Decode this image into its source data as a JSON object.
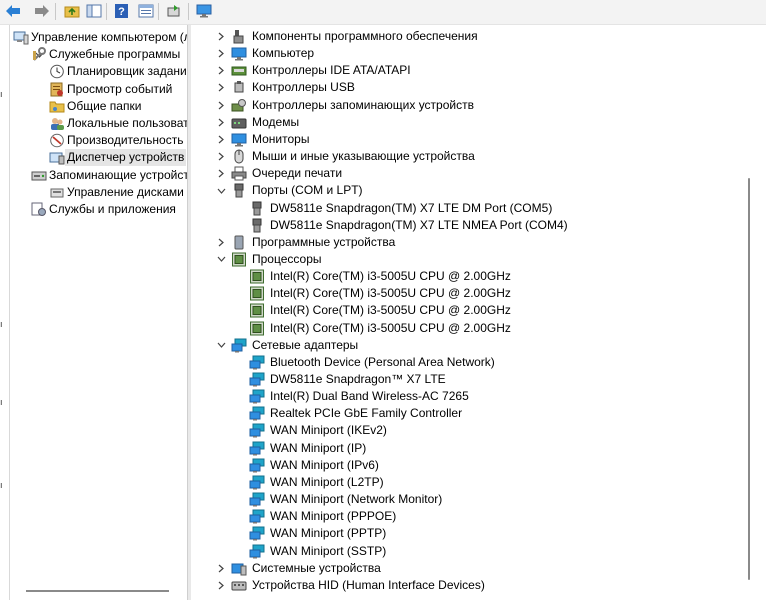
{
  "toolbar": {
    "buttons": [
      {
        "name": "back-button",
        "icon": "arrow-left-icon"
      },
      {
        "name": "forward-button",
        "icon": "arrow-right-icon"
      },
      {
        "name": "up-folder-button",
        "icon": "folder-up-icon"
      },
      {
        "name": "show-hide-tree-button",
        "icon": "console-tree-icon"
      },
      {
        "name": "help-button",
        "icon": "help-icon"
      },
      {
        "name": "properties-button",
        "icon": "properties-icon"
      },
      {
        "name": "update-driver-button",
        "icon": "update-driver-icon"
      },
      {
        "name": "scan-hardware-button",
        "icon": "monitor-scan-icon"
      }
    ]
  },
  "left_tree": [
    {
      "label": "Управление компьютером (л",
      "icon": "computer-management-icon",
      "level": 0,
      "chevron": "none"
    },
    {
      "label": "Служебные программы",
      "icon": "tools-icon",
      "level": 1,
      "chevron": "expanded"
    },
    {
      "label": "Планировщик заданий",
      "icon": "clock-icon",
      "level": 2,
      "chevron": "collapsed"
    },
    {
      "label": "Просмотр событий",
      "icon": "event-viewer-icon",
      "level": 2,
      "chevron": "collapsed"
    },
    {
      "label": "Общие папки",
      "icon": "shared-folder-icon",
      "level": 2,
      "chevron": "collapsed"
    },
    {
      "label": "Локальные пользовате",
      "icon": "users-icon",
      "level": 2,
      "chevron": "collapsed"
    },
    {
      "label": "Производительность",
      "icon": "performance-icon",
      "level": 2,
      "chevron": "collapsed"
    },
    {
      "label": "Диспетчер устройств",
      "icon": "device-manager-icon",
      "level": 2,
      "chevron": "none",
      "selected": true
    },
    {
      "label": "Запоминающие устройст",
      "icon": "storage-icon",
      "level": 1,
      "chevron": "expanded"
    },
    {
      "label": "Управление дисками",
      "icon": "disk-management-icon",
      "level": 2,
      "chevron": "none"
    },
    {
      "label": "Службы и приложения",
      "icon": "services-icon",
      "level": 1,
      "chevron": "collapsed"
    }
  ],
  "device_tree": [
    {
      "label": "Компоненты программного обеспечения",
      "icon": "software-component-icon",
      "level": 0,
      "chevron": "collapsed"
    },
    {
      "label": "Компьютер",
      "icon": "computer-icon",
      "level": 0,
      "chevron": "collapsed"
    },
    {
      "label": "Контроллеры IDE ATA/ATAPI",
      "icon": "ide-controller-icon",
      "level": 0,
      "chevron": "collapsed"
    },
    {
      "label": "Контроллеры USB",
      "icon": "usb-icon",
      "level": 0,
      "chevron": "collapsed"
    },
    {
      "label": "Контроллеры запоминающих устройств",
      "icon": "storage-controller-icon",
      "level": 0,
      "chevron": "collapsed"
    },
    {
      "label": "Модемы",
      "icon": "modem-icon",
      "level": 0,
      "chevron": "collapsed"
    },
    {
      "label": "Мониторы",
      "icon": "monitor-icon",
      "level": 0,
      "chevron": "collapsed"
    },
    {
      "label": "Мыши и иные указывающие устройства",
      "icon": "mouse-icon",
      "level": 0,
      "chevron": "collapsed"
    },
    {
      "label": "Очереди печати",
      "icon": "printer-icon",
      "level": 0,
      "chevron": "collapsed"
    },
    {
      "label": "Порты (COM и LPT)",
      "icon": "port-icon",
      "level": 0,
      "chevron": "expanded"
    },
    {
      "label": "DW5811e Snapdragon(TM) X7 LTE DM Port (COM5)",
      "icon": "port-icon",
      "level": 1,
      "chevron": "none"
    },
    {
      "label": "DW5811e Snapdragon(TM) X7 LTE NMEA Port (COM4)",
      "icon": "port-icon",
      "level": 1,
      "chevron": "none"
    },
    {
      "label": "Программные устройства",
      "icon": "software-device-icon",
      "level": 0,
      "chevron": "collapsed"
    },
    {
      "label": "Процессоры",
      "icon": "processor-icon",
      "level": 0,
      "chevron": "expanded"
    },
    {
      "label": "Intel(R) Core(TM) i3-5005U CPU @ 2.00GHz",
      "icon": "processor-icon",
      "level": 1,
      "chevron": "none"
    },
    {
      "label": "Intel(R) Core(TM) i3-5005U CPU @ 2.00GHz",
      "icon": "processor-icon",
      "level": 1,
      "chevron": "none"
    },
    {
      "label": "Intel(R) Core(TM) i3-5005U CPU @ 2.00GHz",
      "icon": "processor-icon",
      "level": 1,
      "chevron": "none"
    },
    {
      "label": "Intel(R) Core(TM) i3-5005U CPU @ 2.00GHz",
      "icon": "processor-icon",
      "level": 1,
      "chevron": "none"
    },
    {
      "label": "Сетевые адаптеры",
      "icon": "network-adapter-icon",
      "level": 0,
      "chevron": "expanded"
    },
    {
      "label": "Bluetooth Device (Personal Area Network)",
      "icon": "network-adapter-icon",
      "level": 1,
      "chevron": "none"
    },
    {
      "label": "DW5811e Snapdragon™ X7 LTE",
      "icon": "network-adapter-icon",
      "level": 1,
      "chevron": "none"
    },
    {
      "label": "Intel(R) Dual Band Wireless-AC 7265",
      "icon": "network-adapter-icon",
      "level": 1,
      "chevron": "none"
    },
    {
      "label": "Realtek PCIe GbE Family Controller",
      "icon": "network-adapter-icon",
      "level": 1,
      "chevron": "none"
    },
    {
      "label": "WAN Miniport (IKEv2)",
      "icon": "network-adapter-icon",
      "level": 1,
      "chevron": "none"
    },
    {
      "label": "WAN Miniport (IP)",
      "icon": "network-adapter-icon",
      "level": 1,
      "chevron": "none"
    },
    {
      "label": "WAN Miniport (IPv6)",
      "icon": "network-adapter-icon",
      "level": 1,
      "chevron": "none"
    },
    {
      "label": "WAN Miniport (L2TP)",
      "icon": "network-adapter-icon",
      "level": 1,
      "chevron": "none"
    },
    {
      "label": "WAN Miniport (Network Monitor)",
      "icon": "network-adapter-icon",
      "level": 1,
      "chevron": "none"
    },
    {
      "label": "WAN Miniport (PPPOE)",
      "icon": "network-adapter-icon",
      "level": 1,
      "chevron": "none"
    },
    {
      "label": "WAN Miniport (PPTP)",
      "icon": "network-adapter-icon",
      "level": 1,
      "chevron": "none"
    },
    {
      "label": "WAN Miniport (SSTP)",
      "icon": "network-adapter-icon",
      "level": 1,
      "chevron": "none"
    },
    {
      "label": "Системные устройства",
      "icon": "system-device-icon",
      "level": 0,
      "chevron": "collapsed"
    },
    {
      "label": "Устройства HID (Human Interface Devices)",
      "icon": "hid-icon",
      "level": 0,
      "chevron": "collapsed"
    }
  ],
  "colors": {
    "selection": "#e5e5e5",
    "chevron": "#444444",
    "toolbar_bg": "#f3f3f3",
    "monitor_blue": "#2f8fe0",
    "network_teal": "#1fa4c9",
    "cpu_green": "#3e6b2e"
  }
}
